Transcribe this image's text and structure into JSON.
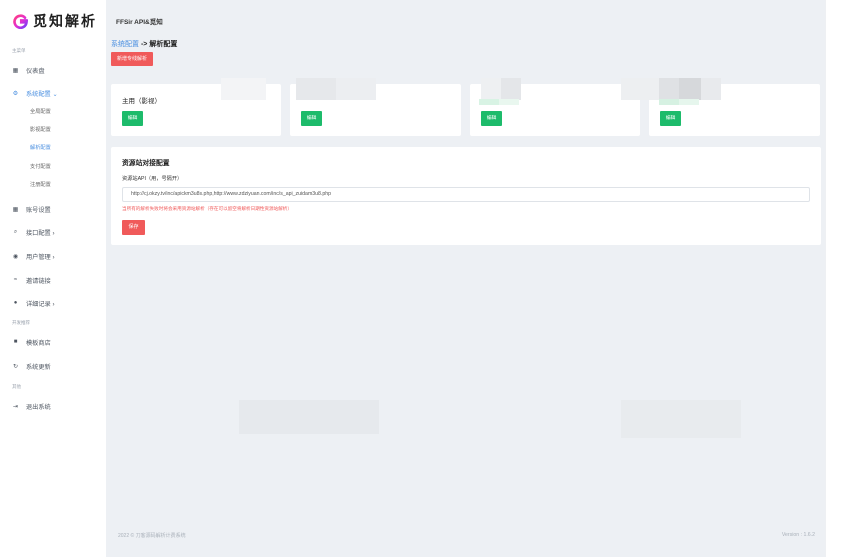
{
  "brand": {
    "name": "觅知解析"
  },
  "sidebar": {
    "section_main": "主菜单",
    "dashboard": "仪表盘",
    "system_config": "系统配置 ⌄",
    "sub_items": [
      "全局配置",
      "影视配置",
      "解析配置",
      "支付配置",
      "注册配置"
    ],
    "account": "账号设置",
    "interface": "接口配置 ›",
    "users": "用户管理 ›",
    "invite": "邀请链接",
    "records": "详细记录 ›",
    "section_dev": "开发推荐",
    "template_store": "模板商店",
    "system_update": "系统更新",
    "section_other": "其他",
    "logout": "退出系统"
  },
  "topbar": {
    "title": "FFSir API&觅知"
  },
  "breadcrumb": {
    "link": "系统配置",
    "current": "-> 解析配置"
  },
  "actions": {
    "add_button": "新增专线解析"
  },
  "cards": [
    {
      "title": "主用（影视）",
      "edit": "编辑"
    },
    {
      "title": "",
      "edit": "编辑"
    },
    {
      "title": "",
      "edit": "编辑"
    },
    {
      "title": "",
      "edit": "编辑"
    }
  ],
  "config": {
    "title": "资源站对接配置",
    "label": "资源站API（用，号隔开）",
    "value": "http://cj.okzy.tv/inc/apickm3u8s.php,http://www.zdziyuan.com/inc/s_api_zuidam3u8.php",
    "hint": "当所有的解析失败时将会采用资源站解析（存在可以留空将解析日期性资源站解析）",
    "save": "保存"
  },
  "footer": {
    "copyright": "2022 © 刀客源码解析计费系统",
    "version": "Version : 1.6.2"
  },
  "colors": {
    "accent_blue": "#4a8fe0",
    "danger_red": "#f05a5a",
    "success_green": "#1dbb6b",
    "bg": "#edf0f4"
  }
}
